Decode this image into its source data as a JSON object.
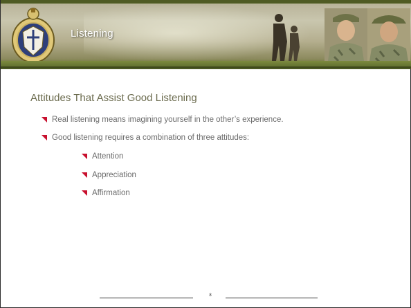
{
  "header": {
    "title": "Listening"
  },
  "content": {
    "heading": "Attitudes That Assist Good Listening",
    "bullets": [
      {
        "text": "Real listening means imagining yourself in the other’s experience."
      },
      {
        "text": "Good listening requires a combination of three attitudes:"
      }
    ],
    "sub_bullets": [
      {
        "text": "Attention"
      },
      {
        "text": "Appreciation"
      },
      {
        "text": "Affirmation"
      }
    ]
  },
  "footer": {
    "page_number": "8"
  },
  "colors": {
    "banner_green": "#6d7a3a",
    "heading_text": "#6b6b4e",
    "body_text": "#6b6b6b",
    "bullet_red": "#c8102e"
  },
  "icons": {
    "seal": "army-chaplain-seal-icon",
    "bullet": "red-triangle-bullet-icon"
  }
}
